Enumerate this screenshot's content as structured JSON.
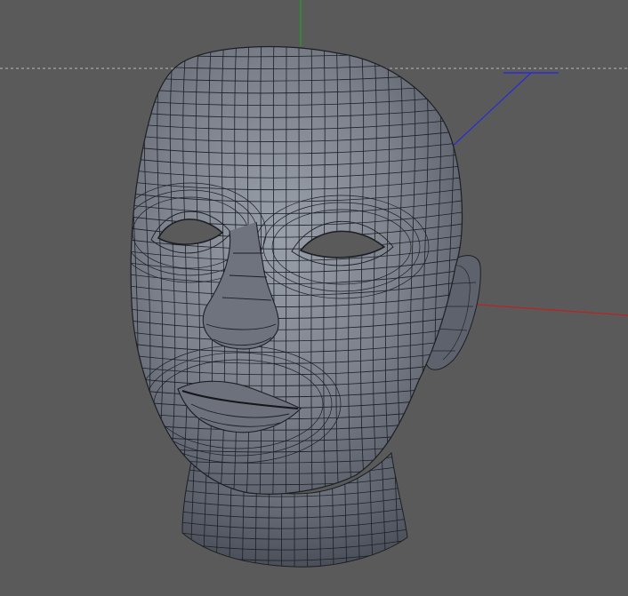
{
  "viewport": {
    "background": "#5a5a5a",
    "horizon_line_color": "#b8b8b8",
    "axes": {
      "x_color": "#c0201e",
      "y_color": "#1fa01f",
      "z_color": "#2b2bd6"
    },
    "object": {
      "name_icon": "head-mesh-icon",
      "mesh_fill": "#7c818c",
      "wire_color": "#1c1f24"
    }
  }
}
